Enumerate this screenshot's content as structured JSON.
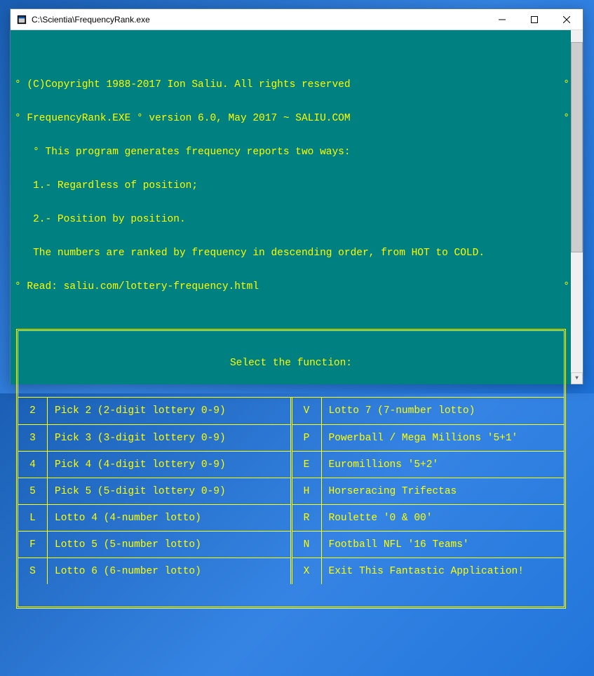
{
  "window": {
    "title": "C:\\Scientia\\FrequencyRank.exe"
  },
  "intro": {
    "copyright": "(C)Copyright 1988-2017 Ion Saliu. All rights reserved",
    "program_line": "FrequencyRank.EXE ° version 6.0, May 2017 ~ SALIU.COM",
    "desc": "This program generates frequency reports two ways:",
    "opt1": "1.- Regardless of position;",
    "opt2": "2.- Position by position.",
    "ranked": "The numbers are ranked by frequency in descending order, from HOT to COLD.",
    "read": "Read: saliu.com/lottery-frequency.html"
  },
  "menu": {
    "title": "Select the function:",
    "left": [
      {
        "key": "2",
        "label": "Pick 2 (2-digit lottery 0-9)"
      },
      {
        "key": "3",
        "label": "Pick 3 (3-digit lottery 0-9)"
      },
      {
        "key": "4",
        "label": "Pick 4 (4-digit lottery 0-9)"
      },
      {
        "key": "5",
        "label": "Pick 5 (5-digit lottery 0-9)"
      },
      {
        "key": "L",
        "label": "Lotto 4 (4-number lotto)"
      },
      {
        "key": "F",
        "label": "Lotto 5 (5-number lotto)"
      },
      {
        "key": "S",
        "label": "Lotto 6 (6-number lotto)"
      }
    ],
    "right": [
      {
        "key": "V",
        "label": "Lotto 7 (7-number lotto)"
      },
      {
        "key": "P",
        "label": "Powerball / Mega Millions '5+1'"
      },
      {
        "key": "E",
        "label": "Euromillions '5+2'"
      },
      {
        "key": "H",
        "label": "Horseracing Trifectas"
      },
      {
        "key": "R",
        "label": "Roulette '0 & 00'"
      },
      {
        "key": "N",
        "label": "Football NFL '16 Teams'"
      },
      {
        "key": "X",
        "label": "Exit This Fantastic Application!"
      }
    ]
  },
  "deg": "°"
}
